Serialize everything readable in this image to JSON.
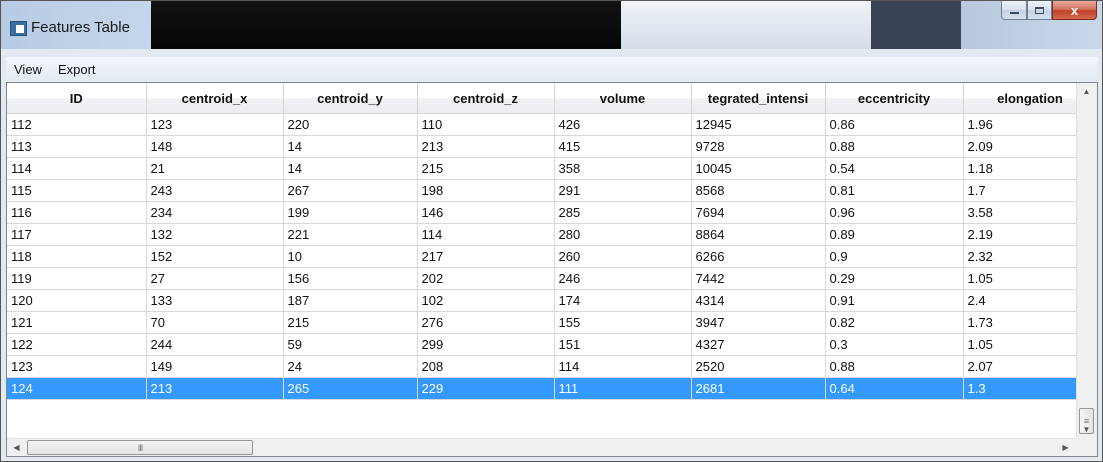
{
  "window": {
    "title": "Features Table",
    "caption_buttons": {
      "minimize": "minimize",
      "maximize": "maximize",
      "close": "x"
    }
  },
  "menu": {
    "items": [
      "View",
      "Export"
    ]
  },
  "table": {
    "columns": [
      "ID",
      "centroid_x",
      "centroid_y",
      "centroid_z",
      "volume",
      "tegrated_intensi",
      "eccentricity",
      "elongation"
    ],
    "rows": [
      [
        "112",
        "123",
        "220",
        "110",
        "426",
        "12945",
        "0.86",
        "1.96"
      ],
      [
        "113",
        "148",
        "14",
        "213",
        "415",
        "9728",
        "0.88",
        "2.09"
      ],
      [
        "114",
        "21",
        "14",
        "215",
        "358",
        "10045",
        "0.54",
        "1.18"
      ],
      [
        "115",
        "243",
        "267",
        "198",
        "291",
        "8568",
        "0.81",
        "1.7"
      ],
      [
        "116",
        "234",
        "199",
        "146",
        "285",
        "7694",
        "0.96",
        "3.58"
      ],
      [
        "117",
        "132",
        "221",
        "114",
        "280",
        "8864",
        "0.89",
        "2.19"
      ],
      [
        "118",
        "152",
        "10",
        "217",
        "260",
        "6266",
        "0.9",
        "2.32"
      ],
      [
        "119",
        "27",
        "156",
        "202",
        "246",
        "7442",
        "0.29",
        "1.05"
      ],
      [
        "120",
        "133",
        "187",
        "102",
        "174",
        "4314",
        "0.91",
        "2.4"
      ],
      [
        "121",
        "70",
        "215",
        "276",
        "155",
        "3947",
        "0.82",
        "1.73"
      ],
      [
        "122",
        "244",
        "59",
        "299",
        "151",
        "4327",
        "0.3",
        "1.05"
      ],
      [
        "123",
        "149",
        "24",
        "208",
        "114",
        "2520",
        "0.88",
        "2.07"
      ],
      [
        "124",
        "213",
        "265",
        "229",
        "111",
        "2681",
        "0.64",
        "1.3"
      ]
    ],
    "selected_row_id": "124"
  },
  "scrollbars": {
    "vertical": {
      "up": "▲",
      "down": "▼",
      "thumb_grip": "≡"
    },
    "horizontal": {
      "left": "◀",
      "right": "▶",
      "thumb_grip": "III"
    }
  },
  "colors": {
    "selection": "#3399ff",
    "window_frame": "#c4d6ea"
  }
}
